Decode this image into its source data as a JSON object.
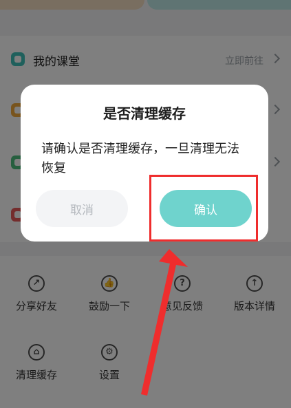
{
  "list": [
    {
      "label": "我的课堂",
      "right": "立即前往",
      "icon_color": "#3fc1b8",
      "icon": "classroom-icon"
    },
    {
      "label": "",
      "right": "",
      "icon_color": "#f0a93b",
      "icon": "orange-icon"
    },
    {
      "label": "",
      "right": "",
      "icon_color": "#4fbf7f",
      "icon": "green-icon"
    },
    {
      "label": "",
      "right": "",
      "icon_color": "#e95a5a",
      "icon": "red-icon"
    }
  ],
  "grid": [
    {
      "label": "分享好友",
      "icon": "share-icon",
      "glyph": "↗"
    },
    {
      "label": "鼓励一下",
      "icon": "thumbs-up-icon",
      "glyph": "👍"
    },
    {
      "label": "意见反馈",
      "icon": "question-icon",
      "glyph": "?"
    },
    {
      "label": "版本详情",
      "icon": "arrow-up-icon",
      "glyph": "↑"
    },
    {
      "label": "清理缓存",
      "icon": "broom-icon",
      "glyph": "⌂"
    },
    {
      "label": "设置",
      "icon": "settings-icon",
      "glyph": "⚙"
    }
  ],
  "dialog": {
    "title": "是否清理缓存",
    "message": "请确认是否清理缓存，一旦清理无法恢复",
    "cancel_label": "取消",
    "confirm_label": "确认"
  },
  "colors": {
    "accent": "#6fd3cd",
    "annotation": "#ef2d2d"
  }
}
